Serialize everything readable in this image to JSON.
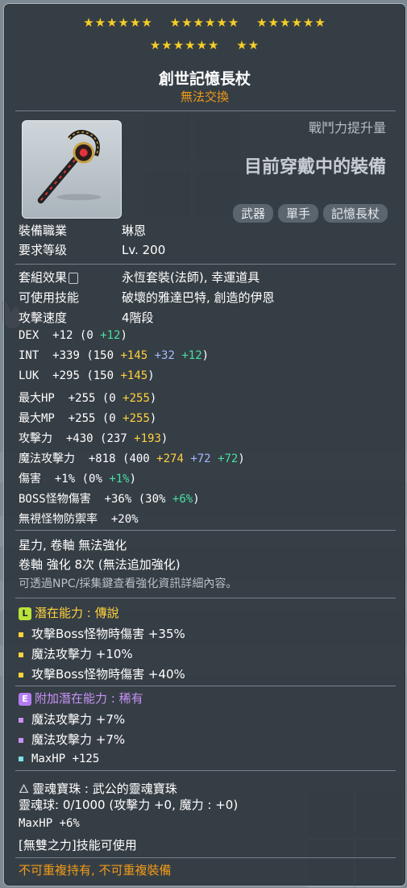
{
  "stars": {
    "row1": [
      "★★★★★★",
      "★★★★★★",
      "★★★★★★"
    ],
    "row2": [
      "★★★★★★",
      "★★"
    ]
  },
  "item": {
    "name": "創世記憶長杖",
    "trade_status": "無法交換",
    "combat_power_label": "戰鬥力提升量",
    "equipped_label": "目前穿戴中的裝備",
    "tags": [
      "武器",
      "單手",
      "記憶長杖"
    ]
  },
  "requirements": {
    "job_label": "裝備職業",
    "job_value": "琳恩",
    "level_label": "要求等级",
    "level_value": "Lv. 200"
  },
  "info": {
    "set_label": "套組效果",
    "set_value": "永恆套裝(法師), 幸運道具",
    "skill_label": "可使用技能",
    "skill_value": "破壞的雅達巴特, 創造的伊恩",
    "speed_label": "攻擊速度",
    "speed_value": "4階段"
  },
  "stats": {
    "dex": {
      "label": "DEX",
      "total": "+12",
      "base": "(0",
      "add": "+12",
      "close": ")"
    },
    "int": {
      "label": "INT",
      "total": "+339",
      "base": "(150",
      "bonus": "+145",
      "flame": "+32",
      "star": "+12",
      "close": ")"
    },
    "luk": {
      "label": "LUK",
      "total": "+295",
      "base": "(150",
      "bonus": "+145",
      "close": ")"
    },
    "hp": {
      "label": "最大HP",
      "total": "+255",
      "base": "(0",
      "bonus": "+255",
      "close": ")"
    },
    "mp": {
      "label": "最大MP",
      "total": "+255",
      "base": "(0",
      "bonus": "+255",
      "close": ")"
    },
    "atk": {
      "label": "攻擊力",
      "total": "+430",
      "base": "(237",
      "bonus": "+193",
      "close": ")"
    },
    "matk": {
      "label": "魔法攻擊力",
      "total": "+818",
      "base": "(400",
      "bonus": "+274",
      "flame": "+72",
      "star": "+72",
      "close": ")"
    },
    "dmg": {
      "label": "傷害",
      "total": "+1%",
      "base": "(0%",
      "add": "+1%",
      "close": ")"
    },
    "boss": {
      "label": "BOSS怪物傷害",
      "total": "+36%",
      "base": "(30%",
      "add": "+6%",
      "close": ")"
    },
    "ied": {
      "label": "無視怪物防禦率",
      "total": "+20%"
    }
  },
  "enhance": {
    "line1": "星力, 卷軸 無法強化",
    "line2": "卷軸 強化 8次 (無法追加強化)",
    "hint": "可透過NPC/採集鍵查看強化資訊詳細內容。"
  },
  "potential": {
    "badge": "L",
    "label": "潛在能力",
    "sep": ":",
    "grade": "傳說",
    "lines": [
      "攻擊Boss怪物時傷害 +35%",
      "魔法攻擊力 +10%",
      "攻擊Boss怪物時傷害 +40%"
    ]
  },
  "additional_potential": {
    "badge": "E",
    "label": "附加潛在能力",
    "sep": ":",
    "grade": "稀有",
    "lines": [
      "魔法攻擊力 +7%",
      "魔法攻擊力 +7%",
      "MaxHP +125"
    ]
  },
  "soul": {
    "title": "靈魂寶珠 : 武公的靈魂寶珠",
    "charge": "靈魂球: 0/1000 (攻擊力 +0, 魔力 : +0)",
    "stat": "MaxHP +6%",
    "skill": "[無雙之力]技能可使用"
  },
  "footer_warning": "不可重複持有, 不可重複裝備",
  "colors": {
    "stars": "#f7cf25",
    "trade_status": "#f09a17",
    "bonus_yellow": "#ffd23d",
    "bonus_green": "#47e0a0",
    "bonus_blue": "#a7b8ff",
    "legendary": "#b9e33a",
    "epic": "#b57cf2"
  }
}
